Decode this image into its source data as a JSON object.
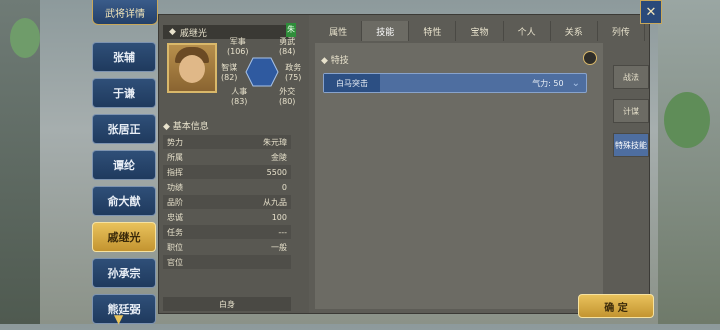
{
  "window": {
    "title": "武将详情",
    "close_icon": "close-icon",
    "confirm_label": "确 定"
  },
  "hero_list": [
    {
      "name": "张辅",
      "active": false
    },
    {
      "name": "于谦",
      "active": false
    },
    {
      "name": "张居正",
      "active": false
    },
    {
      "name": "谭纶",
      "active": false
    },
    {
      "name": "俞大猷",
      "active": false
    },
    {
      "name": "戚继光",
      "active": true
    },
    {
      "name": "孙承宗",
      "active": false
    },
    {
      "name": "熊廷弼",
      "active": false
    }
  ],
  "profile": {
    "name": "戚继光",
    "tag": "朱",
    "stats": [
      {
        "label": "军事",
        "value": "(106)"
      },
      {
        "label": "勇武",
        "value": "(84)"
      },
      {
        "label": "智谋",
        "value": "(82)"
      },
      {
        "label": "政务",
        "value": "(75)"
      },
      {
        "label": "人事",
        "value": "(83)"
      },
      {
        "label": "外交",
        "value": "(80)"
      }
    ],
    "basic_info_title": "基本信息",
    "info": [
      {
        "label": "势力",
        "value": "朱元璋"
      },
      {
        "label": "所属",
        "value": "金陵"
      },
      {
        "label": "指挥",
        "value": "5500"
      },
      {
        "label": "功绩",
        "value": "0"
      },
      {
        "label": "品阶",
        "value": "从九品"
      },
      {
        "label": "忠诚",
        "value": "100"
      },
      {
        "label": "任务",
        "value": "---"
      },
      {
        "label": "职位",
        "value": "一般"
      },
      {
        "label": "官位",
        "value": ""
      }
    ],
    "status": "白身"
  },
  "tabs": [
    {
      "label": "属性"
    },
    {
      "label": "技能",
      "active": true
    },
    {
      "label": "特性"
    },
    {
      "label": "宝物"
    },
    {
      "label": "个人"
    },
    {
      "label": "关系"
    },
    {
      "label": "列传"
    }
  ],
  "skills": {
    "section_title": "特技",
    "items": [
      {
        "name": "白马突击",
        "value": "气力: 50"
      }
    ],
    "menu_icon": "list-icon"
  },
  "side_tabs": [
    {
      "label": "战法"
    },
    {
      "label": "计谋"
    },
    {
      "label": "特殊技能",
      "active": true
    }
  ]
}
